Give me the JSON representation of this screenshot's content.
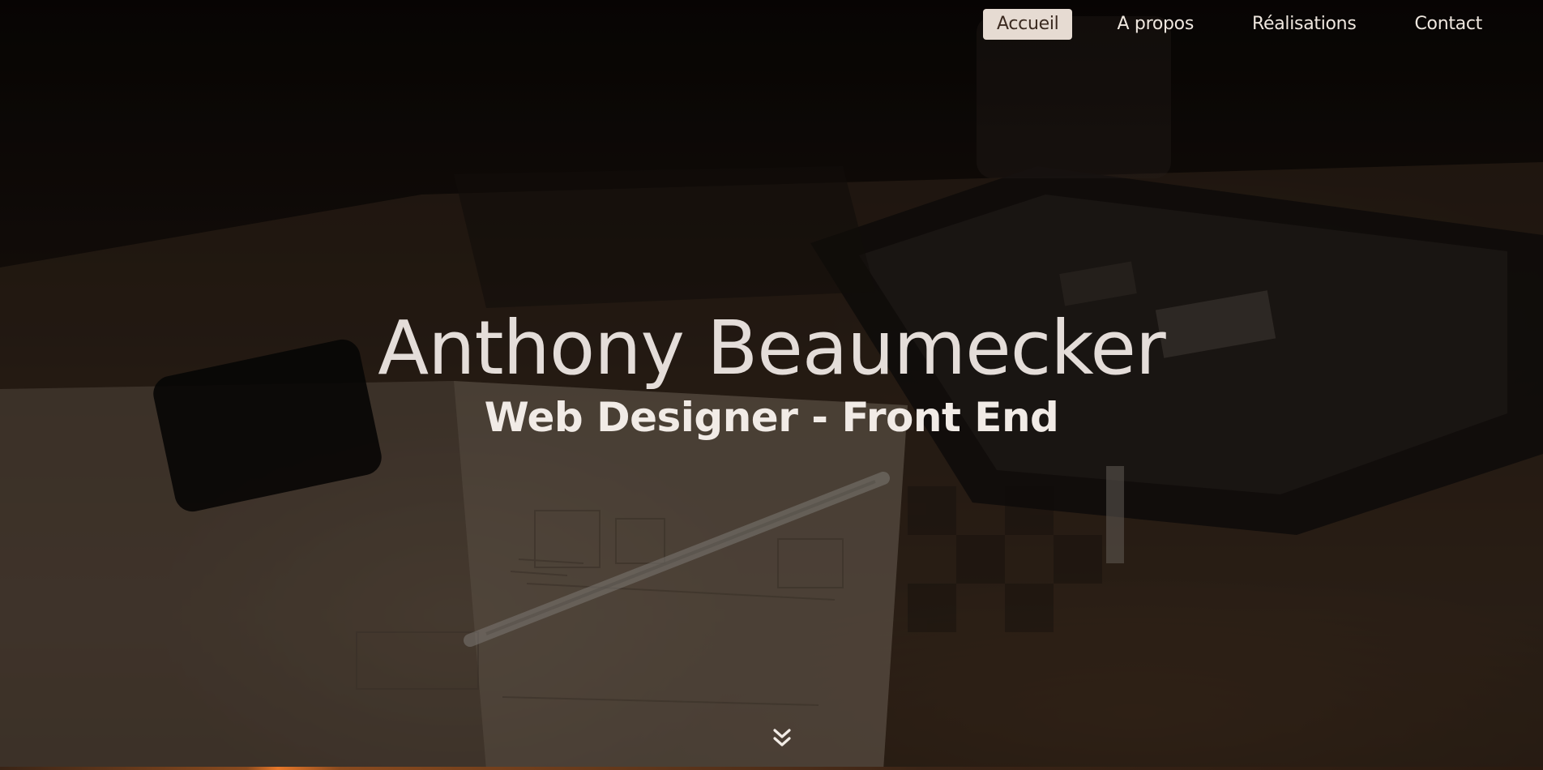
{
  "nav": {
    "items": [
      {
        "label": "Accueil",
        "active": true
      },
      {
        "label": "A propos",
        "active": false
      },
      {
        "label": "Réalisations",
        "active": false
      },
      {
        "label": "Contact",
        "active": false
      }
    ]
  },
  "hero": {
    "name": "Anthony Beaumecker",
    "subtitle": "Web Designer - Front End",
    "scroll_icon": "double-chevron-down-icon"
  },
  "colors": {
    "nav_active_bg": "#e6dbd2",
    "text_light": "#efe7df",
    "accent_orange": "#e8782a"
  }
}
